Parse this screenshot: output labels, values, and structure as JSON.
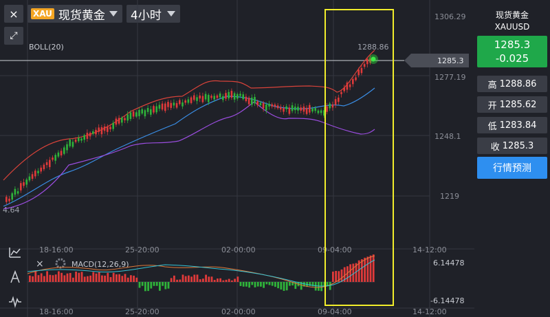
{
  "toolbar": {
    "close_icon": "×",
    "expand_icon": "⤢",
    "symbol_badge": "XAU",
    "symbol_name": "现货黄金",
    "period": "4小时"
  },
  "main_chart": {
    "indicator_label": "BOLL(20)",
    "price_labels": [
      "1306.29",
      "1285.3",
      "1277.19",
      "1248.1",
      "1219"
    ],
    "last_price_tag": "1285.3",
    "high_marker": "1288.86",
    "low_marker": "4.64"
  },
  "time_axis": {
    "labels": [
      "18-16:00",
      "25-20:00",
      "02-00:00",
      "09-04:00",
      "14-12:00"
    ]
  },
  "macd": {
    "label": "MACD(12,26,9)",
    "top_value": "6.14478",
    "bottom_value": "-6.14478",
    "close_icon": "×"
  },
  "quote_panel": {
    "name": "现货黄金",
    "code": "XAUUSD",
    "price": "1285.3",
    "change": "-0.025",
    "high_label": "高",
    "high_value": "1288.86",
    "open_label": "开",
    "open_value": "1285.62",
    "low_label": "低",
    "low_value": "1283.84",
    "close_label": "收",
    "close_value": "1285.3",
    "forecast_button": "行情预测"
  },
  "colors": {
    "background": "#1f2128",
    "up": "#e03a3a",
    "down": "#2fb33a",
    "boll_upper": "#d9433a",
    "boll_middle": "#3a8ee6",
    "boll_lower": "#9b4de0",
    "highlight": "#f2ee2b",
    "quote_bg": "#1fa84a",
    "button_blue": "#2e8ff0"
  }
}
